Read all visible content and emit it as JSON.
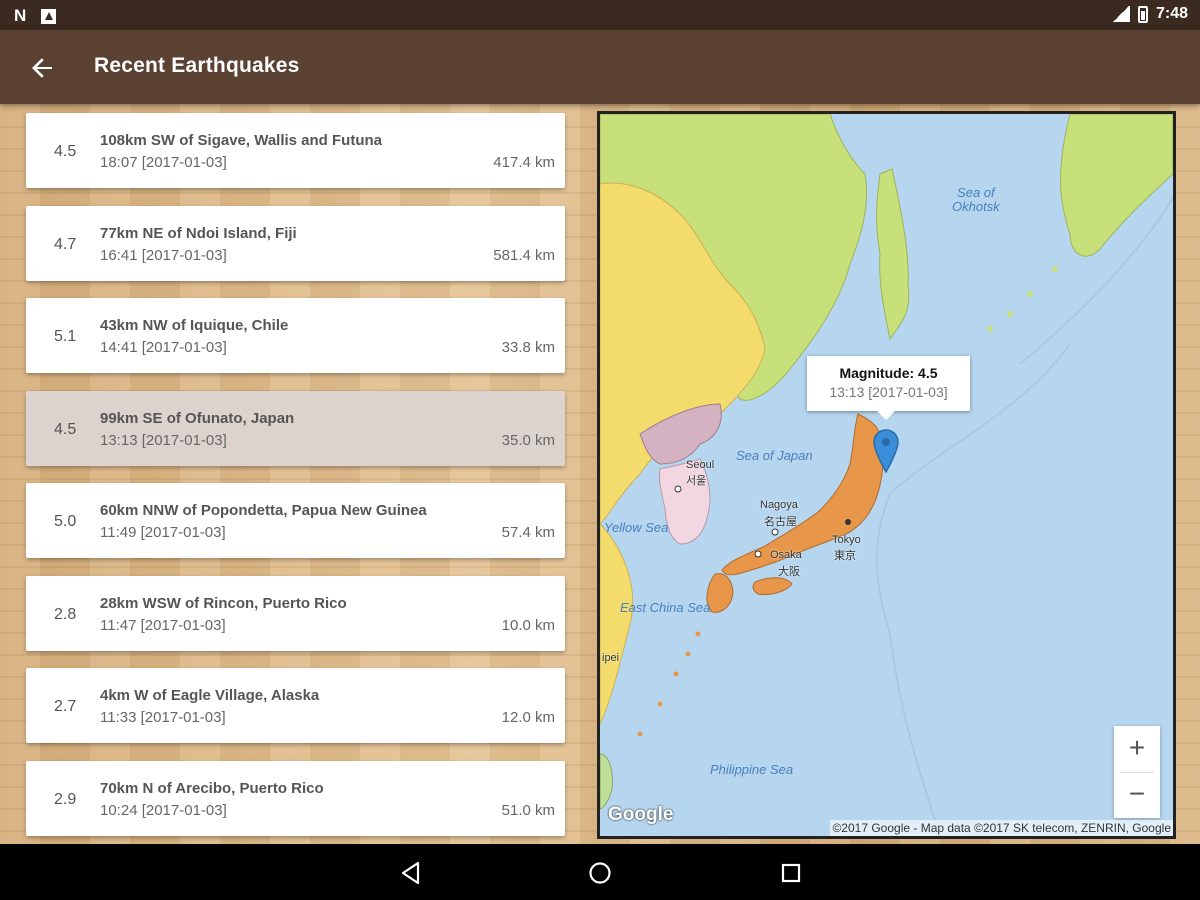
{
  "status_bar": {
    "time": "7:48",
    "icons": [
      "n-notification-icon",
      "image-notification-icon",
      "signal-icon",
      "battery-icon"
    ]
  },
  "app_bar": {
    "back_icon": "arrow-left-icon",
    "title": "Recent Earthquakes"
  },
  "quakes": [
    {
      "magnitude": "4.5",
      "place": "108km SW of Sigave, Wallis and Futuna",
      "time": "18:07  [2017-01-03]",
      "distance": "417.4 km",
      "selected": false
    },
    {
      "magnitude": "4.7",
      "place": "77km NE of Ndoi Island, Fiji",
      "time": "16:41  [2017-01-03]",
      "distance": "581.4 km",
      "selected": false
    },
    {
      "magnitude": "5.1",
      "place": "43km NW of Iquique, Chile",
      "time": "14:41  [2017-01-03]",
      "distance": "33.8 km",
      "selected": false
    },
    {
      "magnitude": "4.5",
      "place": "99km SE of Ofunato, Japan",
      "time": "13:13  [2017-01-03]",
      "distance": "35.0 km",
      "selected": true
    },
    {
      "magnitude": "5.0",
      "place": "60km NNW of Popondetta, Papua New Guinea",
      "time": "11:49  [2017-01-03]",
      "distance": "57.4 km",
      "selected": false
    },
    {
      "magnitude": "2.8",
      "place": "28km WSW of Rincon, Puerto Rico",
      "time": "11:47  [2017-01-03]",
      "distance": "10.0 km",
      "selected": false
    },
    {
      "magnitude": "2.7",
      "place": "4km W of Eagle Village, Alaska",
      "time": "11:33  [2017-01-03]",
      "distance": "12.0 km",
      "selected": false
    },
    {
      "magnitude": "2.9",
      "place": "70km N of Arecibo, Puerto Rico",
      "time": "10:24  [2017-01-03]",
      "distance": "51.0 km",
      "selected": false
    }
  ],
  "map": {
    "info_window": {
      "title": "Magnitude: 4.5",
      "time": "13:13  [2017-01-03]"
    },
    "labels": {
      "sea_of_okhotsk": "Sea of\nOkhotsk",
      "sea_of_japan": "Sea of Japan",
      "yellow_sea": "Yellow Sea",
      "east_china_sea": "East China Sea",
      "philippine_sea": "Philippine Sea",
      "seoul": "Seoul",
      "seoul_local": "서울",
      "nagoya": "Nagoya",
      "nagoya_local": "名古屋",
      "tokyo": "Tokyo",
      "tokyo_local": "東京",
      "osaka": "Osaka",
      "osaka_local": "大阪",
      "taipei_fragment": "ipei"
    },
    "zoom_in": "+",
    "zoom_out": "−",
    "logo": "Google",
    "attribution": "©2017 Google - Map data ©2017 SK telecom, ZENRIN, Google"
  },
  "nav_bar": {
    "icons": [
      "nav-back-icon",
      "nav-home-icon",
      "nav-recents-icon"
    ]
  },
  "colors": {
    "app_bar": "#5a4132",
    "status_bar": "#3b2a20",
    "selected_card": "#dcd3cf",
    "water": "#b6d6f0",
    "japan": "#e8974a",
    "korea": "#d5b2c2",
    "china": "#f3dc6c",
    "russia": "#c7e07a",
    "marker": "#3b8ed8"
  }
}
